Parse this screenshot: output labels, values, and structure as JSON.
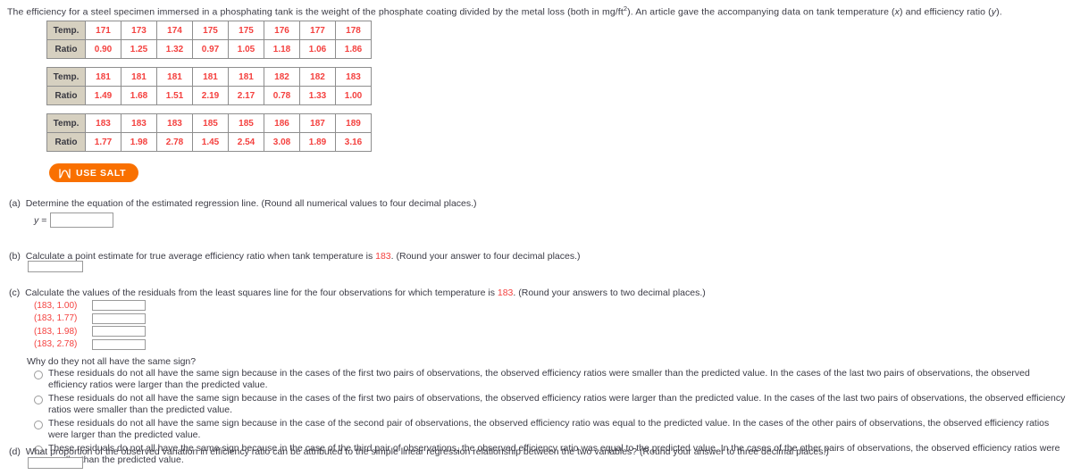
{
  "intro": {
    "part1": "The efficiency for a steel specimen immersed in a phosphating tank is the weight of the phosphate coating divided by the metal loss (both in mg/ft",
    "sup": "2",
    "part2": "). An article gave the accompanying data on tank temperature (",
    "var_x": "x",
    "part3": ") and efficiency ratio (",
    "var_y": "y",
    "part4": ")."
  },
  "tables": [
    {
      "temp_label": "Temp.",
      "ratio_label": "Ratio",
      "temps": [
        "171",
        "173",
        "174",
        "175",
        "175",
        "176",
        "177",
        "178"
      ],
      "ratios": [
        "0.90",
        "1.25",
        "1.32",
        "0.97",
        "1.05",
        "1.18",
        "1.06",
        "1.86"
      ]
    },
    {
      "temp_label": "Temp.",
      "ratio_label": "Ratio",
      "temps": [
        "181",
        "181",
        "181",
        "181",
        "181",
        "182",
        "182",
        "183"
      ],
      "ratios": [
        "1.49",
        "1.68",
        "1.51",
        "2.19",
        "2.17",
        "0.78",
        "1.33",
        "1.00"
      ]
    },
    {
      "temp_label": "Temp.",
      "ratio_label": "Ratio",
      "temps": [
        "183",
        "183",
        "183",
        "185",
        "185",
        "186",
        "187",
        "189"
      ],
      "ratios": [
        "1.77",
        "1.98",
        "2.78",
        "1.45",
        "2.54",
        "3.08",
        "1.89",
        "3.16"
      ]
    }
  ],
  "salt_button": {
    "label": "USE SALT",
    "icon": "salt-distribution-icon",
    "color": "#f97000"
  },
  "part_a": {
    "marker": "(a)",
    "text": "Determine the equation of the estimated regression line. (Round all numerical values to four decimal places.)",
    "y_equals": "y =",
    "input_value": ""
  },
  "part_b": {
    "marker": "(b)",
    "text_before": "Calculate a point estimate for true average efficiency ratio when tank temperature is",
    "highlight": "183",
    "text_after": ". (Round your answer to four decimal places.)",
    "input_value": ""
  },
  "part_c": {
    "marker": "(c)",
    "text_before": "Calculate the values of the residuals from the least squares line for the four observations for which temperature is",
    "highlight": "183",
    "text_after": ". (Round your answers to two decimal places.)",
    "residuals": [
      {
        "pair": "(183, 1.00)",
        "input_value": ""
      },
      {
        "pair": "(183, 1.77)",
        "input_value": ""
      },
      {
        "pair": "(183, 1.98)",
        "input_value": ""
      },
      {
        "pair": "(183, 2.78)",
        "input_value": ""
      }
    ],
    "why_question": "Why do they not all have the same sign?",
    "options": [
      "These residuals do not all have the same sign because in the cases of the first two pairs of observations, the observed efficiency ratios were smaller than the predicted value. In the cases of the last two pairs of observations, the observed efficiency ratios were larger than the predicted value.",
      "These residuals do not all have the same sign because in the cases of the first two pairs of observations, the observed efficiency ratios were larger than the predicted value. In the cases of the last two pairs of observations, the observed efficiency ratios were smaller than the predicted value.",
      "These residuals do not all have the same sign because in the case of the second pair of observations, the observed efficiency ratio was equal to the predicted value. In the cases of the other pairs of observations, the observed efficiency ratios were larger than the predicted value.",
      "These residuals do not all have the same sign because in the case of the third pair of observations, the observed efficiency ratio was equal to the predicted value. In the cases of the other pairs of observations, the observed efficiency ratios were smaller than the predicted value."
    ],
    "selected_option": null
  },
  "part_d": {
    "marker": "(d)",
    "text": "What proportion of the observed variation in efficiency ratio can be attributed to the simple linear regression relationship between the two variables? (Round your answer to three decimal places.)",
    "input_value": ""
  }
}
